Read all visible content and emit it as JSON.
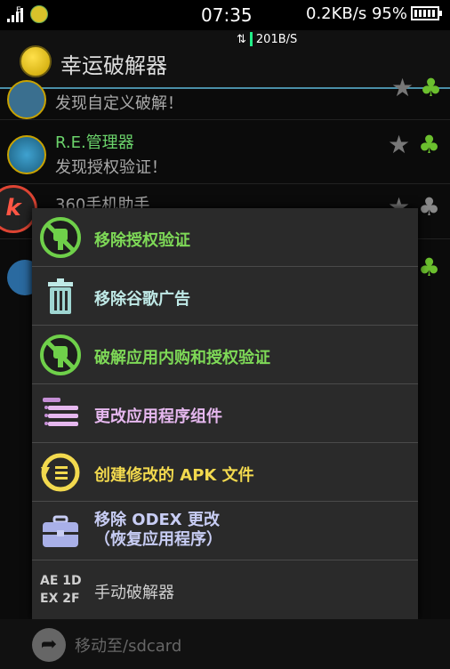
{
  "status_bar": {
    "network_label": "E",
    "time": "07:35",
    "speed_battery": "0.2KB/s 95%",
    "battery_level": 0.95,
    "net_speed": "201B/S"
  },
  "app_bar": {
    "title": "幸运破解器"
  },
  "list": {
    "items": [
      {
        "name": "",
        "desc": "发现自定义破解！"
      },
      {
        "name": "R.E.管理器",
        "desc": "发现授权验证！"
      },
      {
        "name": "360手机助手",
        "desc": ""
      }
    ]
  },
  "floating_badge": "k",
  "menu": {
    "items": [
      {
        "label": "移除授权验证",
        "icon": "no-license-icon",
        "color": "#7ed957"
      },
      {
        "label": "移除谷歌广告",
        "icon": "trash-icon",
        "color": "#bfe9e6"
      },
      {
        "label": "破解应用内购和授权验证",
        "icon": "no-license-icon",
        "color": "#7ed957"
      },
      {
        "label": "更改应用程序组件",
        "icon": "components-icon",
        "color": "#e6b8ef"
      },
      {
        "label": "创建修改的 APK 文件",
        "icon": "rebuild-icon",
        "color": "#f2d94e"
      },
      {
        "label": "移除 ODEX 更改\n（恢复应用程序）",
        "icon": "toolbox-icon",
        "color": "#c8cdf4"
      },
      {
        "label": "手动破解器",
        "icon": "hex-icon",
        "color": "#cfcfcf",
        "hex": [
          "AE 1D",
          "EX 2F"
        ]
      }
    ]
  },
  "bottom_bar": {
    "label": "移动至/sdcard"
  }
}
